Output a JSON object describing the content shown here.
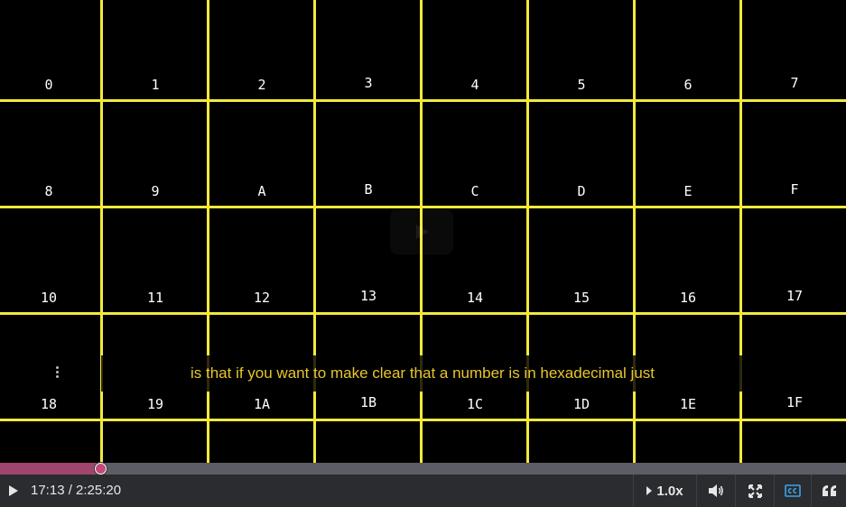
{
  "grid": {
    "labels": [
      "0",
      "1",
      "2",
      "3",
      "4",
      "5",
      "6",
      "7",
      "8",
      "9",
      "A",
      "B",
      "C",
      "D",
      "E",
      "F",
      "10",
      "11",
      "12",
      "13",
      "14",
      "15",
      "16",
      "17",
      "18",
      "19",
      "1A",
      "1B",
      "1C",
      "1D",
      "1E",
      "1F"
    ],
    "line_color": "#f2ea3a"
  },
  "caption": {
    "text": "is that if you want to make clear that a number is in hexadecimal just",
    "color": "#e7c62a"
  },
  "player": {
    "current_time": "17:13",
    "duration": "2:25:20",
    "time_display": "17:13 / 2:25:20",
    "progress_fraction": 0.1185,
    "speed_label": "1.0x",
    "icons": [
      "play-icon",
      "volume-icon",
      "fullscreen-icon",
      "closed-captions-icon",
      "quote-icon"
    ],
    "progress_color": "#a0456e",
    "cc_color": "#3ba5e8"
  }
}
